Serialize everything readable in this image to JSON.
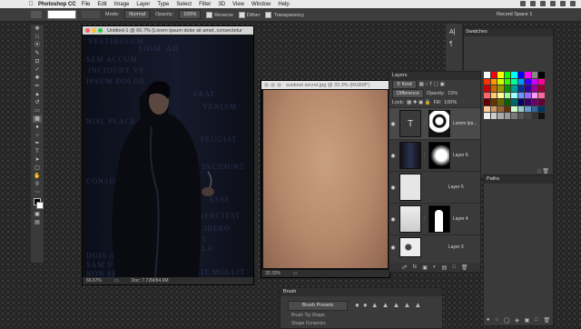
{
  "menubar": {
    "app_name": "Photoshop CC",
    "items": [
      "File",
      "Edit",
      "Image",
      "Layer",
      "Type",
      "Select",
      "Filter",
      "3D",
      "View",
      "Window",
      "Help"
    ]
  },
  "options": {
    "mode_label": "Mode:",
    "mode_value": "Normal",
    "opacity_label": "Opacity:",
    "opacity_value": "100%",
    "reverse_label": "Reverse",
    "dither_label": "Dither",
    "transparency_label": "Transparency",
    "workspace": "Record Space 1"
  },
  "doc1": {
    "title": "Untitled-1 @ 66.7% (Lorem ipsum dolor sit amet, consectetur",
    "zoom": "66.67%",
    "doc_size": "Doc: 7.72M/84.6M",
    "text_lines": [
      "VESTIBULUM",
      "ENIM. AD",
      "SEM ACCUM",
      "INCIDUNT VS",
      "IPSUM DOLOR",
      "ERAT",
      "VENIAM",
      "NISL PLACE",
      "FEUGIAT",
      "INCIDUNT",
      "CONSEQUAT",
      "ESSE",
      "EXERCITAT",
      "LIBERO",
      "EIT",
      "NULLA",
      "DUIS AUTE",
      "SAM VOLUPTATE",
      "VELIT MOLLIT",
      "NON PROIDENT"
    ]
  },
  "doc2": {
    "title": "sunkest secret.jpg @ 33.3% (RGB/8*)",
    "zoom": "33.33%"
  },
  "layers": {
    "tab": "Layers",
    "filter_kind": "Kind",
    "blend_mode": "Difference",
    "opacity_label": "Opacity:",
    "opacity_value": "15%",
    "lock_label": "Lock:",
    "fill_label": "Fill:",
    "fill_value": "100%",
    "items": [
      {
        "name": "Lorem Ips...",
        "type": "text"
      },
      {
        "name": "Layer 6",
        "type": "image"
      },
      {
        "name": "Layer 5",
        "type": "plain"
      },
      {
        "name": "Layer 4",
        "type": "image"
      },
      {
        "name": "Layer 3",
        "type": "image"
      }
    ]
  },
  "swatches": {
    "tab": "Swatches",
    "colors": [
      "#ffffff",
      "#ff0000",
      "#ffff00",
      "#00ff00",
      "#00ffff",
      "#0000ff",
      "#ff00ff",
      "#888888",
      "#000000",
      "#ff3300",
      "#ff9900",
      "#ccff00",
      "#33ff00",
      "#00ff99",
      "#0099ff",
      "#3300ff",
      "#cc00ff",
      "#ff0099",
      "#cc0000",
      "#cc6600",
      "#999900",
      "#009900",
      "#009999",
      "#003399",
      "#330099",
      "#990099",
      "#990033",
      "#ff6666",
      "#ffcc66",
      "#ffff99",
      "#99ff99",
      "#99ffff",
      "#6699ff",
      "#9966ff",
      "#ff99ff",
      "#ff6699",
      "#660000",
      "#663300",
      "#666600",
      "#006600",
      "#006666",
      "#000066",
      "#330066",
      "#660066",
      "#660033",
      "#ffcc99",
      "#cc9966",
      "#996633",
      "#663300",
      "#ccffcc",
      "#99cccc",
      "#6699cc",
      "#336699",
      "#003366",
      "#eeeeee",
      "#cccccc",
      "#aaaaaa",
      "#999999",
      "#777777",
      "#555555",
      "#444444",
      "#333333",
      "#111111"
    ]
  },
  "paths": {
    "tab": "Paths"
  },
  "brush": {
    "tab": "Brush",
    "presets_button": "Brush Presets",
    "tip_label": "Brush Tip Shape",
    "dynamics_label": "Shape Dynamics"
  }
}
